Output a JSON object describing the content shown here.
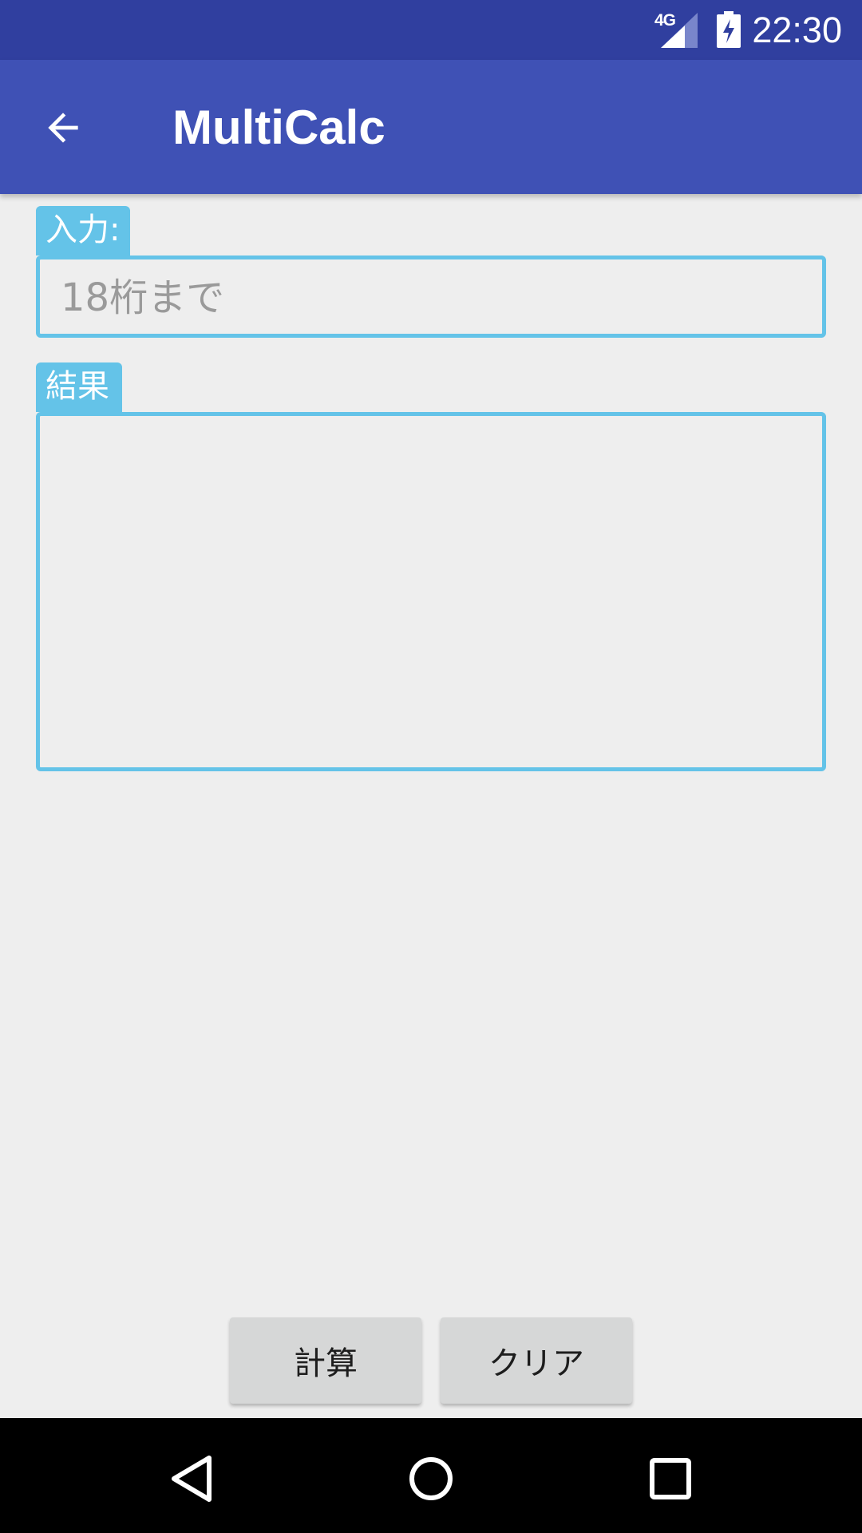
{
  "status_bar": {
    "network": "4G",
    "time": "22:30",
    "signal_icon": "signal-icon",
    "battery_icon": "battery-charging-icon"
  },
  "app_bar": {
    "title": "MultiCalc",
    "back_icon": "arrow-back-icon"
  },
  "input": {
    "label": "入力:",
    "placeholder": "18桁まで",
    "value": ""
  },
  "result": {
    "label": "結果",
    "value": ""
  },
  "buttons": {
    "calculate": "計算",
    "clear": "クリア"
  },
  "nav_bar": {
    "back_icon": "nav-back-icon",
    "home_icon": "nav-home-icon",
    "recents_icon": "nav-recents-icon"
  },
  "colors": {
    "status_bar": "#303f9f",
    "app_bar": "#3f51b5",
    "accent_border": "#64c3e8",
    "background": "#eeeeee",
    "button": "#d6d7d7"
  }
}
